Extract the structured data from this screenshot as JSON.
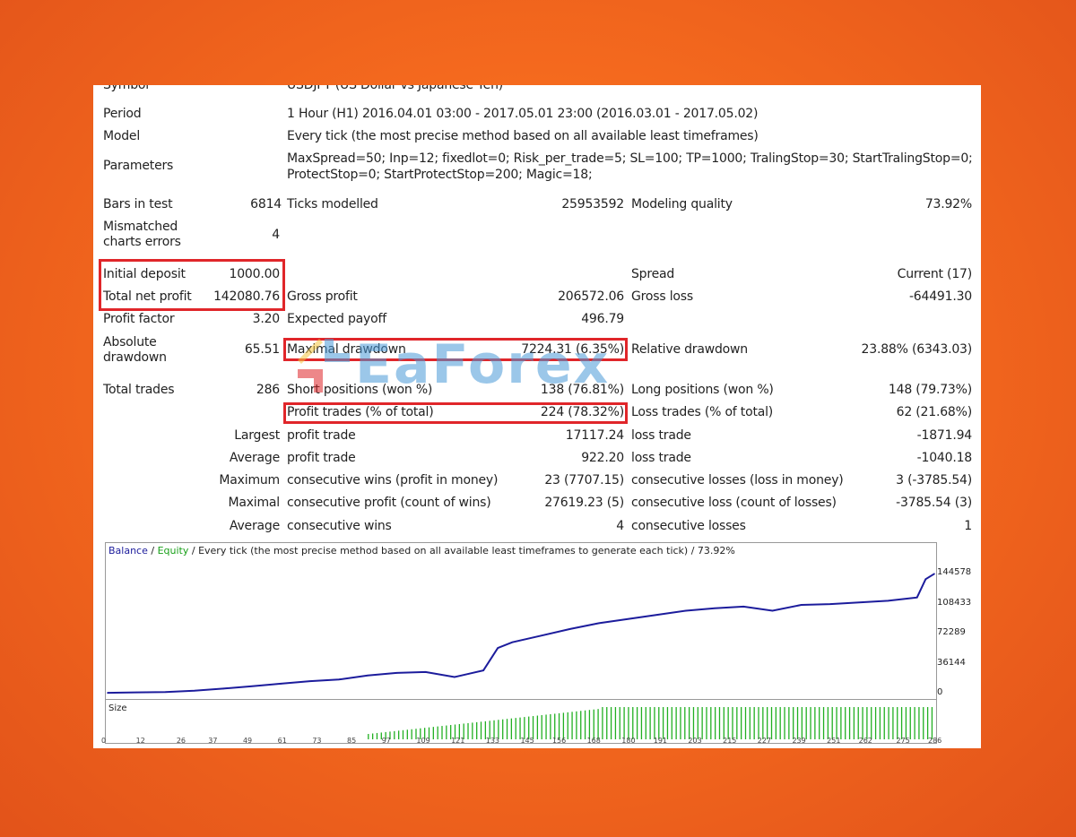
{
  "report": {
    "symbol": {
      "label": "Symbol",
      "value": "USDJPY (US Dollar vs Japanese Yen)"
    },
    "period": {
      "label": "Period",
      "value": "1 Hour (H1) 2016.04.01 03:00 - 2017.05.01 23:00 (2016.03.01 - 2017.05.02)"
    },
    "model": {
      "label": "Model",
      "value": "Every tick (the most precise method based on all available least timeframes)"
    },
    "parameters": {
      "label": "Parameters",
      "line1": "MaxSpread=50; Inp=12; fixedlot=0; Risk_per_trade=5; SL=100; TP=1000; TralingStop=30; StartTralingStop=0;",
      "line2": "ProtectStop=0; StartProtectStop=200; Magic=18;"
    },
    "bars_in_test": {
      "label": "Bars in test",
      "value": "6814"
    },
    "ticks_modelled": {
      "label": "Ticks modelled",
      "value": "25953592"
    },
    "modeling_quality": {
      "label": "Modeling quality",
      "value": "73.92%"
    },
    "mismatched": {
      "label1": "Mismatched",
      "label2": "charts errors",
      "value": "4"
    },
    "initial_deposit": {
      "label": "Initial deposit",
      "value": "1000.00"
    },
    "spread": {
      "label": "Spread",
      "value": "Current (17)"
    },
    "total_net_profit": {
      "label": "Total net profit",
      "value": "142080.76"
    },
    "gross_profit": {
      "label": "Gross profit",
      "value": "206572.06"
    },
    "gross_loss": {
      "label": "Gross loss",
      "value": "-64491.30"
    },
    "profit_factor": {
      "label": "Profit factor",
      "value": "3.20"
    },
    "expected_payoff": {
      "label": "Expected payoff",
      "value": "496.79"
    },
    "absolute_drawdown": {
      "label1": "Absolute",
      "label2": "drawdown",
      "value": "65.51"
    },
    "maximal_drawdown": {
      "label": "Maximal drawdown",
      "value": "7224.31 (6.35%)"
    },
    "relative_drawdown": {
      "label": "Relative drawdown",
      "value": "23.88% (6343.03)"
    },
    "total_trades": {
      "label": "Total trades",
      "value": "286"
    },
    "short_positions": {
      "label": "Short positions (won %)",
      "value": "138 (76.81%)"
    },
    "long_positions": {
      "label": "Long positions (won %)",
      "value": "148 (79.73%)"
    },
    "profit_trades": {
      "label": "Profit trades (% of total)",
      "value": "224 (78.32%)"
    },
    "loss_trades": {
      "label": "Loss trades (% of total)",
      "value": "62 (21.68%)"
    },
    "largest": {
      "label": "Largest",
      "profit_label": "profit trade",
      "profit_value": "17117.24",
      "loss_label": "loss trade",
      "loss_value": "-1871.94"
    },
    "average": {
      "label": "Average",
      "profit_label": "profit trade",
      "profit_value": "922.20",
      "loss_label": "loss trade",
      "loss_value": "-1040.18"
    },
    "maximum": {
      "label": "Maximum",
      "wins_label": "consecutive wins (profit in money)",
      "wins_value": "23 (7707.15)",
      "losses_label": "consecutive losses (loss in money)",
      "losses_value": "3 (-3785.54)"
    },
    "maximal": {
      "label": "Maximal",
      "profit_label": "consecutive profit (count of wins)",
      "profit_value": "27619.23 (5)",
      "loss_label": "consecutive loss (count of losses)",
      "loss_value": "-3785.54 (3)"
    },
    "average_consec": {
      "label": "Average",
      "wins_label": "consecutive wins",
      "wins_value": "4",
      "losses_label": "consecutive losses",
      "losses_value": "1"
    }
  },
  "watermark": {
    "text": "EaForex"
  },
  "chart": {
    "title_balance": "Balance",
    "title_sep1": " / ",
    "title_equity": "Equity",
    "title_rest": " / Every tick (the most precise method based on all available least timeframes to generate each tick) / 73.92%",
    "size_label": "Size",
    "colors": {
      "balance": "#1c1c9c",
      "equity": "#18a018",
      "size_bars": "#22b022",
      "highlight": "#e0262a"
    }
  },
  "chart_data": {
    "type": "line",
    "series": [
      {
        "name": "Balance",
        "x": [
          0,
          10,
          20,
          30,
          40,
          50,
          60,
          70,
          80,
          90,
          100,
          110,
          120,
          125,
          130,
          135,
          140,
          150,
          160,
          170,
          180,
          190,
          200,
          210,
          220,
          230,
          240,
          250,
          260,
          270,
          280,
          283,
          286
        ],
        "y": [
          1000,
          1500,
          2000,
          3500,
          6000,
          9000,
          12000,
          15000,
          17000,
          22000,
          25000,
          26000,
          20000,
          24000,
          28000,
          55000,
          62000,
          70000,
          78000,
          85000,
          90000,
          95000,
          100000,
          103000,
          105000,
          100000,
          107000,
          108000,
          110000,
          112000,
          116000,
          138000,
          144578
        ]
      }
    ],
    "yticks": [
      0,
      36144,
      72289,
      108433,
      144578
    ],
    "ylim": [
      0,
      160000
    ],
    "xlim": [
      0,
      286
    ],
    "xticks": [
      0,
      12,
      26,
      37,
      49,
      61,
      73,
      85,
      97,
      109,
      121,
      133,
      145,
      156,
      168,
      180,
      191,
      203,
      215,
      227,
      239,
      251,
      262,
      275,
      286
    ],
    "size_bars": {
      "x_start": 90,
      "x_end": 286,
      "low_start": 170,
      "high_from": 170
    }
  }
}
